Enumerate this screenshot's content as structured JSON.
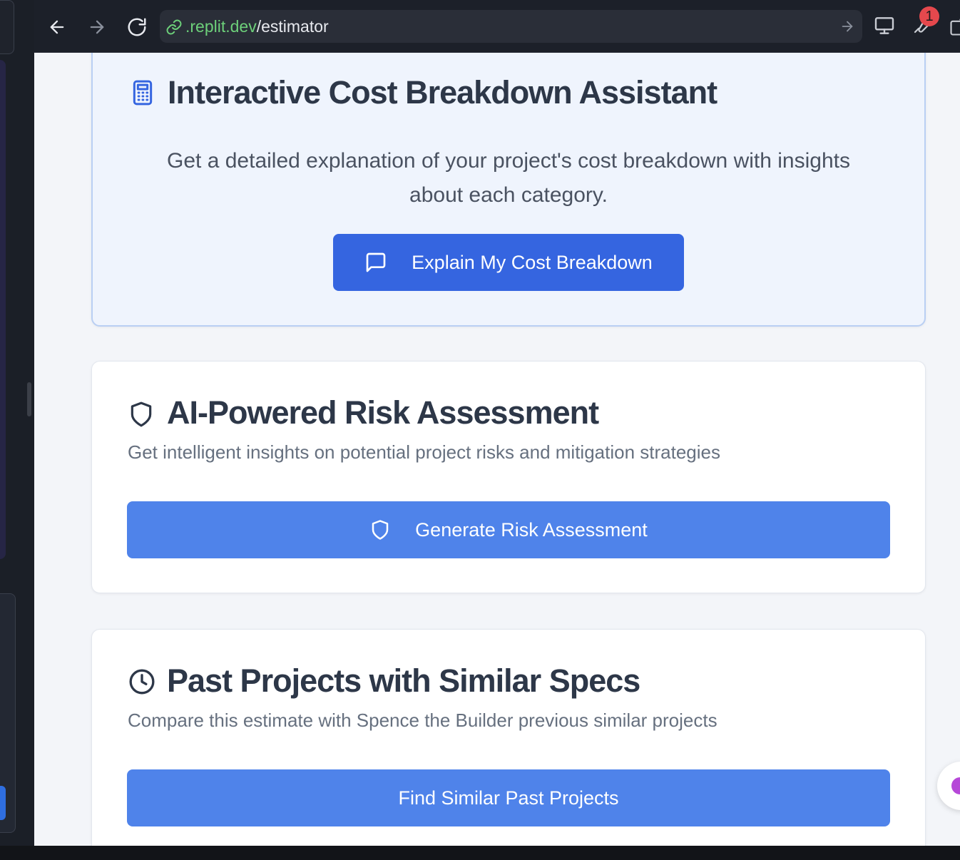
{
  "browser": {
    "url_domain": ".replit.dev",
    "url_path": "/estimator",
    "notification_count": "1"
  },
  "cost_card": {
    "title": "Interactive Cost Breakdown Assistant",
    "description_line1": "Get a detailed explanation of your project's cost breakdown with insights",
    "description_line2": "about each category.",
    "button_label": "Explain My Cost Breakdown"
  },
  "risk_card": {
    "title": "AI-Powered Risk Assessment",
    "description": "Get intelligent insights on potential project risks and mitigation strategies",
    "button_label": "Generate Risk Assessment"
  },
  "past_card": {
    "title": "Past Projects with Similar Specs",
    "description": "Compare this estimate with Spence the Builder previous similar projects",
    "button_label": "Find Similar Past Projects"
  },
  "colors": {
    "primary_button": "#4f83ea",
    "primary_button_dark": "#3565e0",
    "url_domain": "#6dd07a",
    "badge": "#e5484d"
  }
}
